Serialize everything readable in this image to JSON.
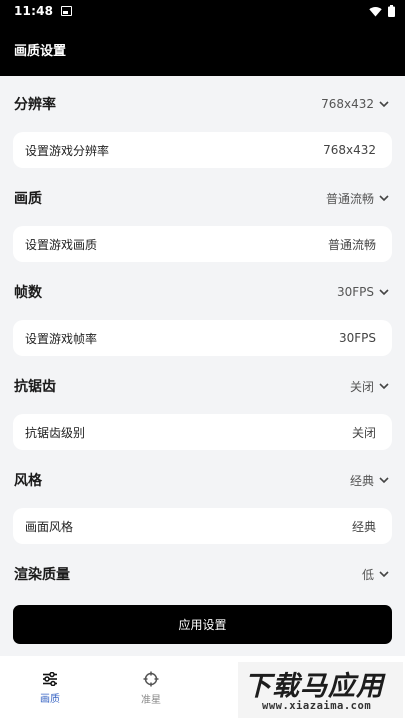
{
  "status_bar": {
    "time": "11:48"
  },
  "app_bar": {
    "title": "画质设置"
  },
  "sections": [
    {
      "title": "分辨率",
      "value": "768x432",
      "card_label": "设置游戏分辨率",
      "card_value": "768x432"
    },
    {
      "title": "画质",
      "value": "普通流畅",
      "card_label": "设置游戏画质",
      "card_value": "普通流畅"
    },
    {
      "title": "帧数",
      "value": "30FPS",
      "card_label": "设置游戏帧率",
      "card_value": "30FPS"
    },
    {
      "title": "抗锯齿",
      "value": "关闭",
      "card_label": "抗锯齿级别",
      "card_value": "关闭"
    },
    {
      "title": "风格",
      "value": "经典",
      "card_label": "画面风格",
      "card_value": "经典"
    },
    {
      "title": "渲染质量",
      "value": "低"
    }
  ],
  "apply_button": {
    "label": "应用设置"
  },
  "bottom_nav": [
    {
      "label": "画质",
      "icon": "sliders-icon",
      "active": true
    },
    {
      "label": "准星",
      "icon": "crosshair-icon",
      "active": false
    }
  ],
  "watermark": {
    "main": "下载马应用",
    "sub": "www.xiazaima.com"
  },
  "colors": {
    "accent": "#3a66c4",
    "bar_bg": "#000000",
    "page_bg": "#f3f4f6"
  }
}
